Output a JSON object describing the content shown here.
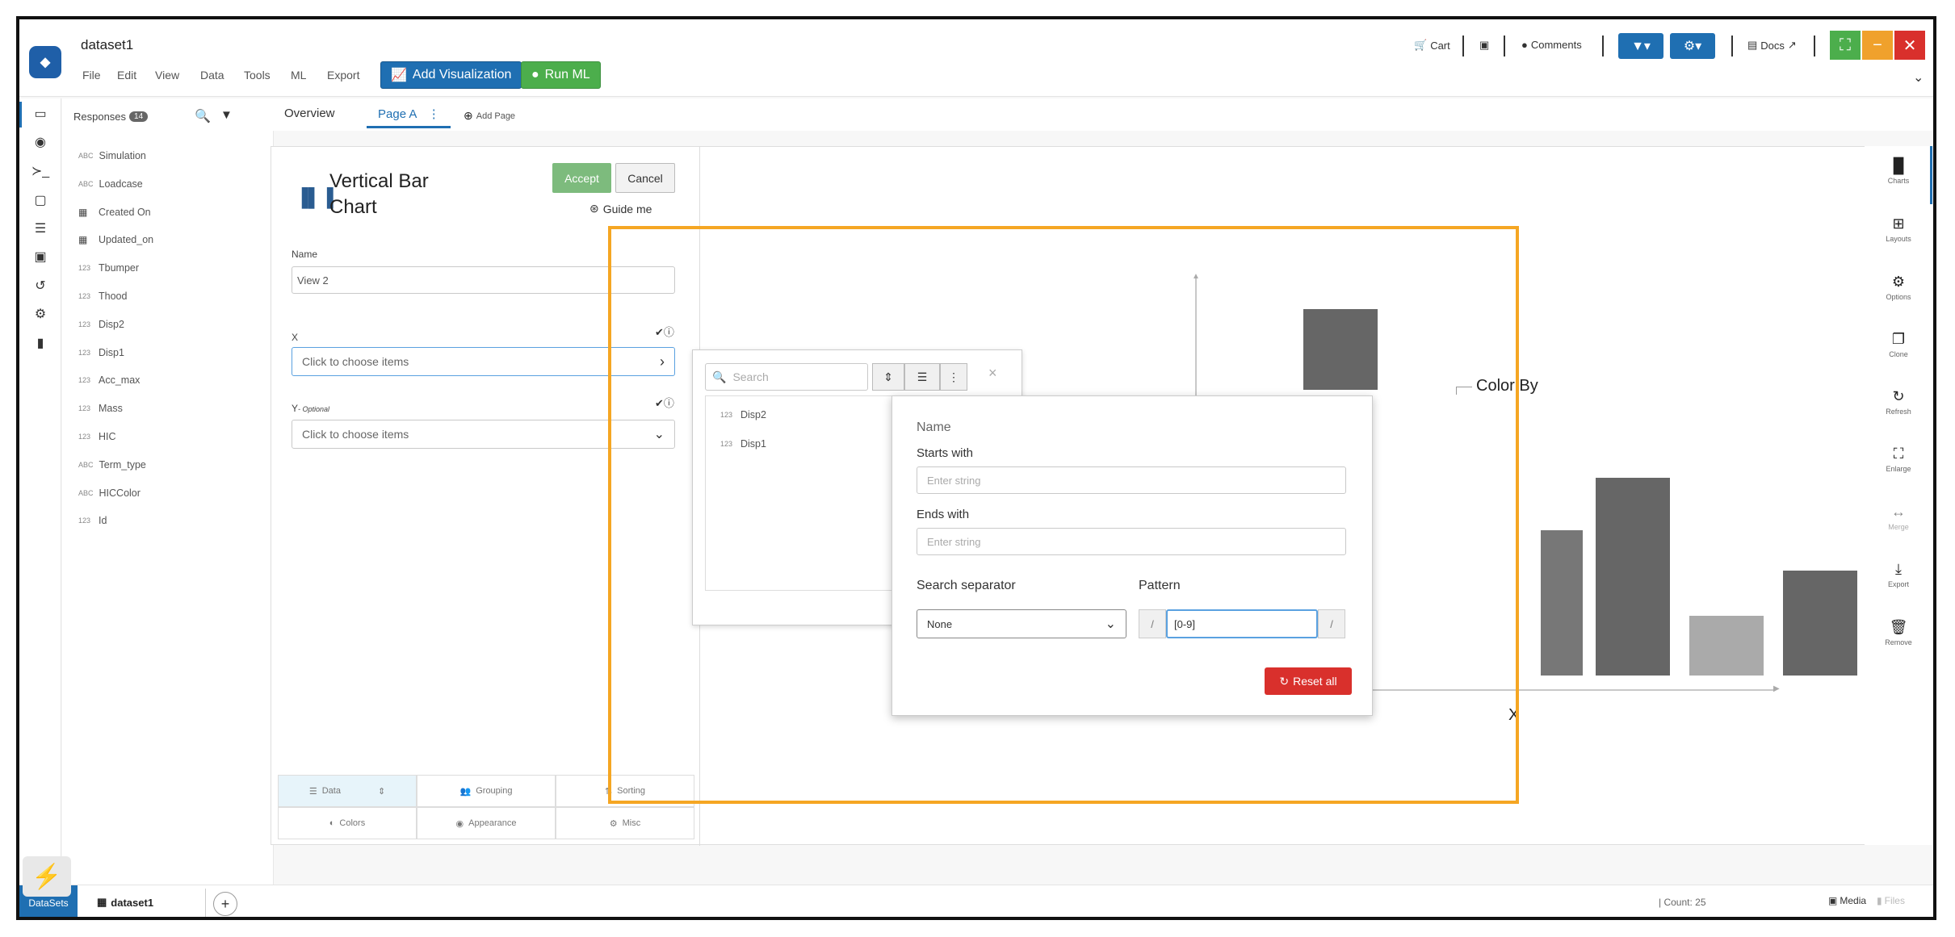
{
  "header": {
    "title": "dataset1",
    "menu": [
      "File",
      "Edit",
      "View",
      "Data",
      "Tools",
      "ML",
      "Export"
    ],
    "add_visualization": "Add Visualization",
    "run_ml": "Run ML",
    "cart": "Cart",
    "comments": "Comments",
    "docs": "Docs"
  },
  "fields_panel": {
    "title": "Responses",
    "count": "14",
    "items": [
      {
        "type": "ABC",
        "label": "Simulation"
      },
      {
        "type": "ABC",
        "label": "Loadcase"
      },
      {
        "type": "",
        "label": "Created On"
      },
      {
        "type": "",
        "label": "Updated_on"
      },
      {
        "type": "123",
        "label": "Tbumper"
      },
      {
        "type": "123",
        "label": "Thood"
      },
      {
        "type": "123",
        "label": "Disp2"
      },
      {
        "type": "123",
        "label": "Disp1"
      },
      {
        "type": "123",
        "label": "Acc_max"
      },
      {
        "type": "123",
        "label": "Mass"
      },
      {
        "type": "123",
        "label": "HIC"
      },
      {
        "type": "ABC",
        "label": "Term_type"
      },
      {
        "type": "ABC",
        "label": "HICColor"
      },
      {
        "type": "123",
        "label": "Id"
      }
    ]
  },
  "tabs": {
    "overview": "Overview",
    "page_a": "Page A",
    "add_page": "Add Page"
  },
  "config": {
    "chart_title": "Vertical Bar Chart",
    "accept": "Accept",
    "cancel": "Cancel",
    "guide": "Guide me",
    "name_label": "Name",
    "name_value": "View 2",
    "x_label": "X",
    "x_placeholder": "Click to choose items",
    "y_label": "Y",
    "y_optional": "- Optional",
    "y_placeholder": "Click to choose items",
    "grid": [
      "Data",
      "Grouping",
      "Sorting",
      "Colors",
      "Appearance",
      "Misc"
    ]
  },
  "chart_preview": {
    "color_by": "Color By",
    "x_axis": "X"
  },
  "chart_data": {
    "type": "bar",
    "categories": [
      "",
      "",
      "",
      "",
      "",
      "",
      "",
      ""
    ],
    "values": [],
    "title": "",
    "xlabel": "X",
    "ylabel": ""
  },
  "search_popup": {
    "placeholder": "Search",
    "items": [
      {
        "type": "123",
        "label": "Disp2"
      },
      {
        "type": "123",
        "label": "Disp1"
      }
    ]
  },
  "filter_popup": {
    "name": "Name",
    "starts_with": "Starts with",
    "starts_placeholder": "Enter string",
    "ends_with": "Ends with",
    "ends_placeholder": "Enter string",
    "separator_label": "Search separator",
    "separator_value": "None",
    "pattern_label": "Pattern",
    "pattern_value": "[0-9]",
    "slash": "/",
    "reset_all": "Reset all"
  },
  "right_rail": [
    "Charts",
    "Layouts",
    "Options",
    "Clone",
    "Refresh",
    "Enlarge",
    "Merge",
    "Export",
    "Remove"
  ],
  "bottom": {
    "datasets": "DataSets",
    "tab": "dataset1",
    "count": "Count: 25",
    "media": "Media",
    "files": "Files"
  },
  "colors": {
    "primary": "#1f6fb2",
    "green": "#4cae4c",
    "accept": "#7dbb7d",
    "reset": "#d9302c",
    "highlight": "#f5a623"
  }
}
